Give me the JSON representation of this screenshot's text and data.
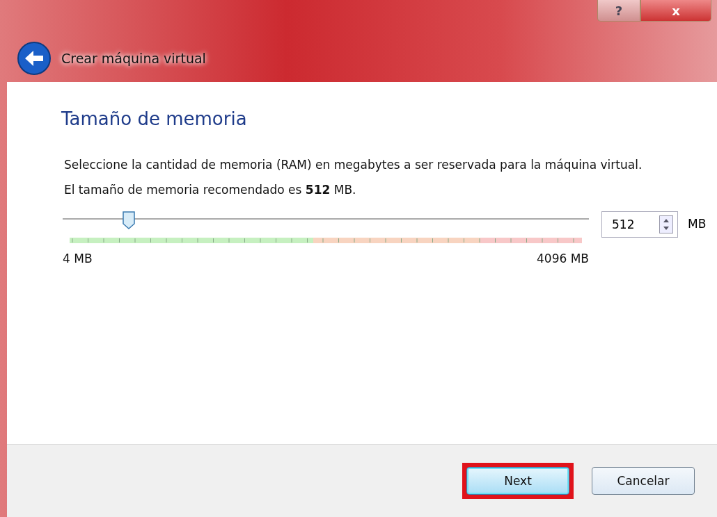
{
  "window": {
    "title": "Crear máquina virtual",
    "controls": [
      {
        "kind": "help",
        "label": "?"
      },
      {
        "kind": "close",
        "label": "x"
      }
    ]
  },
  "page": {
    "heading": "Tamaño de memoria",
    "description": "Seleccione la cantidad de memoria (RAM) en megabytes a ser reservada para la máquina virtual.",
    "recommendation": "El tamaño de memoria recomendado es **512** MB."
  },
  "memory_slider": {
    "level": 0.125,
    "min_label": "4 MB",
    "max_label": "4096 MB"
  },
  "memory_field": {
    "value": "512",
    "unit": "MB"
  },
  "buttons": [
    {
      "label": "Next",
      "default": true,
      "highlighted": true
    },
    {
      "label": "Cancelar",
      "default": false,
      "highlighted": false
    }
  ]
}
